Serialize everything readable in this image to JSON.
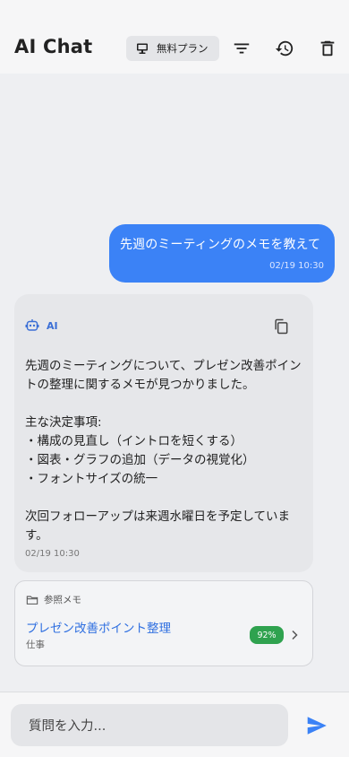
{
  "app_bar": {
    "title": "AI Chat",
    "plan_label": "無料プラン"
  },
  "icons": {
    "plan": "monitor-icon",
    "filter": "filter-icon",
    "history": "history-icon",
    "delete": "trash-icon",
    "bot": "robot-icon",
    "copy": "copy-icon",
    "folder": "folder-icon",
    "chevron": "chevron-right-icon",
    "send": "send-icon"
  },
  "messages": {
    "user": {
      "text": "先週のミーティングのメモを教えて",
      "time": "02/19 10:30"
    },
    "ai": {
      "sender": "AI",
      "lines": [
        "先週のミーティングについて、プレゼン改善ポイントの整理に関するメモが見つかりました。",
        "",
        "主な決定事項:",
        "・構成の見直し（イントロを短くする）",
        "・図表・グラフの追加（データの視覚化）",
        "・フォントサイズの統一",
        "",
        "次回フォローアップは来週水曜日を予定しています。"
      ],
      "time": "02/19 10:30"
    }
  },
  "reference": {
    "label": "参照メモ",
    "title": "プレゼン改善ポイント整理",
    "category": "仕事",
    "score": "92%"
  },
  "composer": {
    "placeholder": "質問を入力..."
  },
  "colors": {
    "accent": "#3b82f6",
    "score_badge": "#2fa24f"
  }
}
